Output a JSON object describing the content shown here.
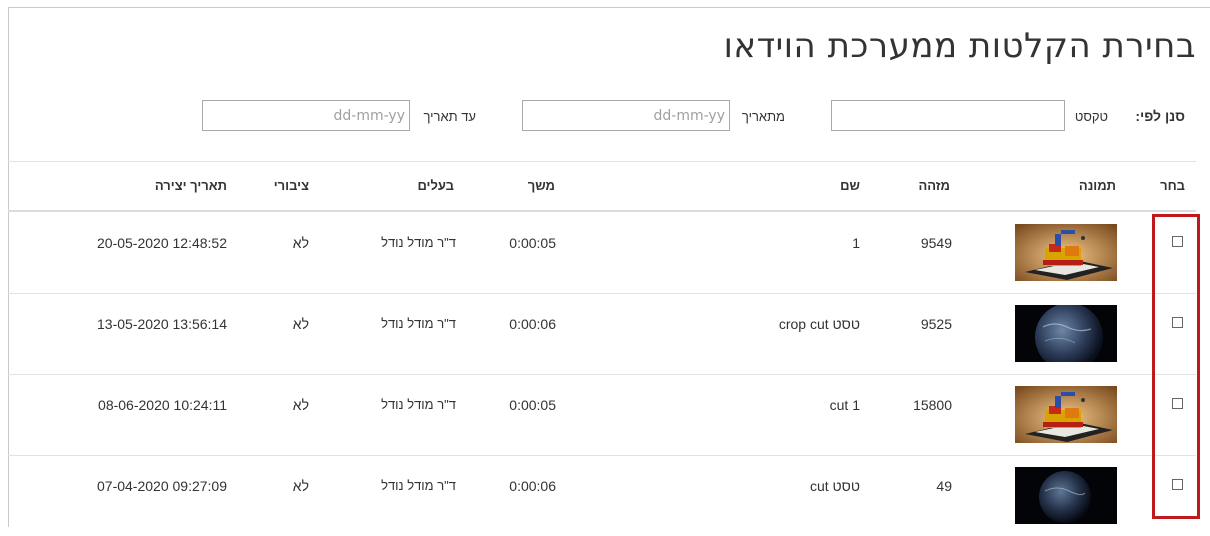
{
  "page": {
    "title": "בחירת הקלטות ממערכת הוידאו"
  },
  "filters": {
    "filter_by_label": "סנן לפי:",
    "text_label": "טקסט",
    "text_value": "",
    "from_date_label": "מתאריך",
    "from_date_placeholder": "dd-mm-yy",
    "to_date_label": "עד תאריך",
    "to_date_placeholder": "dd-mm-yy"
  },
  "table": {
    "headers": {
      "select": "בחר",
      "image": "תמונה",
      "id": "מזהה",
      "name": "שם",
      "duration": "משך",
      "owner": "בעלים",
      "public": "ציבורי",
      "created": "תאריך יצירה"
    },
    "rows": [
      {
        "thumbnail": "robot-thumbnail",
        "id": "9549",
        "name": "1",
        "duration": "0:00:05",
        "owner": "ד\"ר מודל נודל",
        "public": "לא",
        "created": "20-05-2020 12:48:52"
      },
      {
        "thumbnail": "earth-thumbnail",
        "id": "9525",
        "name": "טסט crop cut",
        "duration": "0:00:06",
        "owner": "ד\"ר מודל נודל",
        "public": "לא",
        "created": "13-05-2020 13:56:14"
      },
      {
        "thumbnail": "robot-thumbnail",
        "id": "15800",
        "name": "cut 1",
        "duration": "0:00:05",
        "owner": "ד\"ר מודל נודל",
        "public": "לא",
        "created": "08-06-2020 10:24:11"
      },
      {
        "thumbnail": "earth-thumbnail",
        "id": "49",
        "name": "טסט cut",
        "duration": "0:00:06",
        "owner": "ד\"ר מודל נודל",
        "public": "לא",
        "created": "07-04-2020 09:27:09"
      }
    ]
  },
  "colors": {
    "highlight": "#c0191d",
    "divider": "#e2e2e2",
    "text": "#333333"
  }
}
